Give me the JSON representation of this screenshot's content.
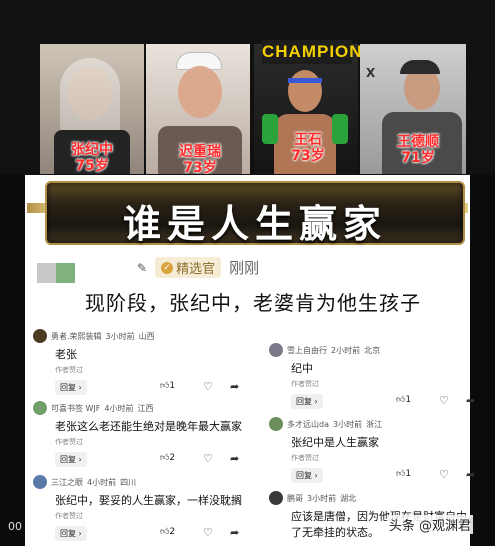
{
  "collage": {
    "sign_text": "CHAMPIONS",
    "people": [
      {
        "name": "张纪中",
        "age": "75岁"
      },
      {
        "name": "迟重瑞",
        "age": "73岁"
      },
      {
        "name": "王石",
        "age": "73岁"
      },
      {
        "name": "王德顺",
        "age": "71岁"
      }
    ]
  },
  "banner": {
    "title": "谁是人生赢家"
  },
  "post": {
    "badge": "精选官",
    "time": "刚刚",
    "text": "现阶段，张纪中，老婆肯为他生孩子"
  },
  "comments_left": [
    {
      "user": "勇者.荣熙装辑",
      "time": "3小时前",
      "loc": "山西",
      "text": "老张",
      "note": "作者赞过",
      "reply": "回复 ›",
      "likes": "1"
    },
    {
      "user": "可喜书签 WJF",
      "time": "4小时前",
      "loc": "江西",
      "text": "老张这么老还能生绝对是晚年最大赢家",
      "note": "作者赞过",
      "reply": "回复 ›",
      "likes": "2"
    },
    {
      "user": "三江之眼",
      "time": "4小时前",
      "loc": "四川",
      "text": "张纪中，娶妥的人生赢家，一样没耽搁",
      "note": "作者赞过",
      "reply": "回复 ›",
      "likes": "2"
    }
  ],
  "comments_right": [
    {
      "user": "雪上自由行",
      "time": "2小时前",
      "loc": "北京",
      "text": "纪中",
      "note": "作者赞过",
      "reply": "回复 ›",
      "likes": "1"
    },
    {
      "user": "多才远山da",
      "time": "3小时前",
      "loc": "浙江",
      "text": "张纪中是人生赢家",
      "note": "作者赞过",
      "reply": "回复 ›",
      "likes": "1"
    },
    {
      "user": "鹏哥",
      "time": "3小时前",
      "loc": "湖北",
      "text": "应该是唐僧，因为他现在是财富自由，",
      "text2": "了无牵挂的状态。"
    }
  ],
  "watermark": "头条 @观渊君",
  "side_glyph": "00"
}
